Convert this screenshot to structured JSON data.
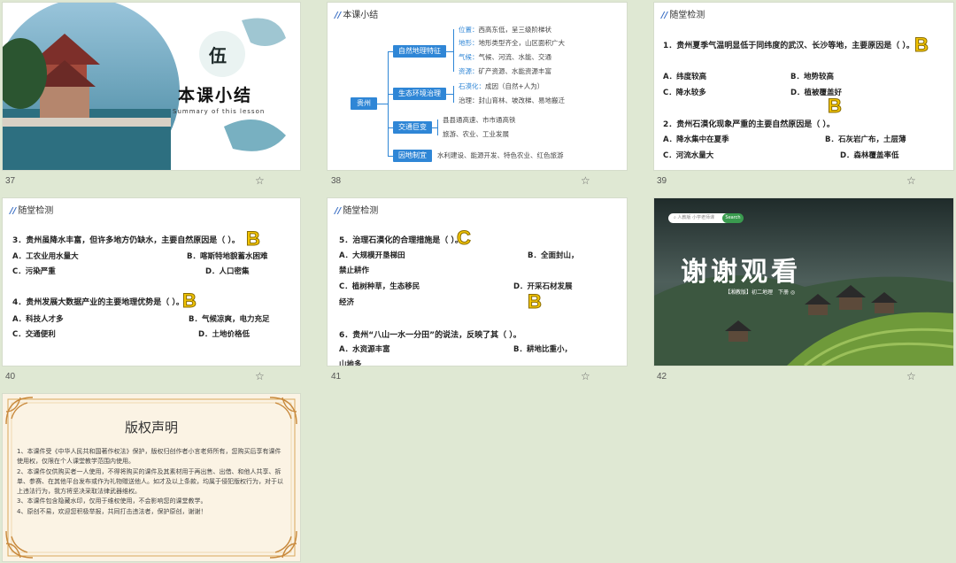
{
  "slides": [
    {
      "num": "37",
      "title": "本课小结",
      "subtitle": "Summary of this lesson",
      "badge": "伍"
    },
    {
      "num": "38",
      "header": "本课小结",
      "root": "贵州",
      "b1": {
        "label": "自然地理特征",
        "items": [
          {
            "k": "位置：",
            "v": "西高东低，呈三级阶梯状"
          },
          {
            "k": "地形：",
            "v": "地形类型齐全，山区面积广大"
          },
          {
            "k": "气候：",
            "v": "气候、河流、水能、交通"
          },
          {
            "k": "资源：",
            "v": "矿产资源、水能资源丰富"
          }
        ]
      },
      "b2": {
        "label": "生态环境治理",
        "items": [
          {
            "k": "石漠化：",
            "v": "成因（自然+人为）"
          },
          {
            "k": "",
            "v": "治理：封山育林、坡改梯、易地搬迁"
          }
        ]
      },
      "b3": {
        "label": "交通巨变",
        "items": [
          {
            "v": "县县通高速、市市通高铁"
          },
          {
            "v": "旅游、农业、工业发展"
          }
        ]
      },
      "b4": {
        "label": "因地制宜",
        "text": "水利建设、能源开发、特色农业、红色旅游"
      }
    },
    {
      "num": "39",
      "header": "随堂检测",
      "q1": "1．贵州夏季气温明显低于同纬度的武汉、长沙等地，主要原因是（      ）。",
      "q1o": [
        "A．纬度较高",
        "B．地势较高",
        "C．降水较多",
        "D．植被覆盖好"
      ],
      "q1a": "B",
      "q2": "2．贵州石漠化现象严重的主要自然原因是（      ）。",
      "q2o": [
        "A．降水集中在夏季",
        "B．石灰岩广布，土层薄",
        "C．河流水量大",
        "D．森林覆盖率低"
      ],
      "q2a": "B"
    },
    {
      "num": "40",
      "header": "随堂检测",
      "q3": "3．贵州虽降水丰富，但许多地方仍缺水，主要自然原因是（      ）。",
      "q3o": [
        "A．工农业用水量大",
        "B．喀斯特地貌蓄水困难",
        "C．污染严重",
        "D．人口密集"
      ],
      "q3a": "B",
      "q4": "4．贵州发展大数据产业的主要地理优势是（      ）。",
      "q4o": [
        "A．科技人才多",
        "B．气候凉爽，电力充足",
        "C．交通便利",
        "D．土地价格低"
      ],
      "q4a": "B"
    },
    {
      "num": "41",
      "header": "随堂检测",
      "q5": "5．治理石漠化的合理措施是（      ）。",
      "q5o": [
        "A．大规模开垦梯田",
        "B．全面封山，",
        "禁止耕作",
        "C．植树种草，生态移民",
        "D．开采石材发展",
        "经济"
      ],
      "q5a": "C",
      "q5a2": "B",
      "q6": "6．贵州“八山一水一分田”的说法，反映了其（      ）。",
      "q6o": [
        "A．水资源丰富",
        "B．耕地比重小，",
        "山地多"
      ]
    },
    {
      "num": "42",
      "title": "谢谢观看",
      "search_placeholder": "人教版 小学老师课",
      "search_btn": "Search",
      "sub": "【湘教版】初二地理　下册 ◎"
    },
    {
      "title": "版权声明",
      "paras": [
        "1、本课件受《中华人民共和国著作权法》保护，版权归创作者小言老师所有，您购买后享有课件使用权，仅限在个人课堂教学范围内使用。",
        "2、本课件仅供购买者一人使用，不得将购买的课件及其素材用于再出售、出借、和他人共享、拆单、参赛、在其他平台发布或作为礼物赠送他人。如才及以上条款，均属于侵犯版权行为，对于以上违法行为，我方将坚决采取法律武器维权。",
        "3、本课件包含隐藏水印，仅用于维权使用，不会影响您的课堂教学。",
        "4、原创不易，欢迎您积极举报，共同打击违法者，保护原创，谢谢！"
      ]
    }
  ],
  "colors": {
    "accent": "#2f86d6",
    "answer": "#f2c400",
    "bg": "#dfe8d3"
  }
}
